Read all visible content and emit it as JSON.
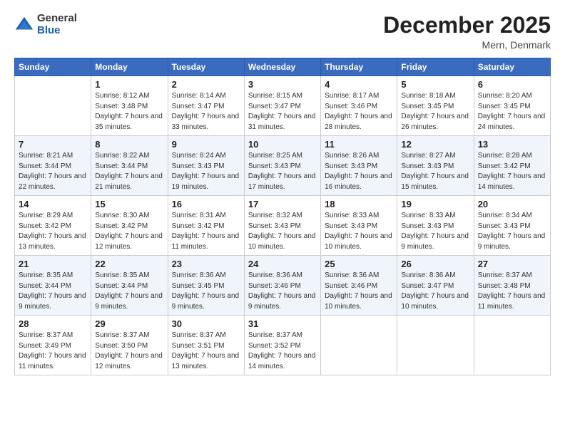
{
  "logo": {
    "general": "General",
    "blue": "Blue"
  },
  "calendar": {
    "title": "December 2025",
    "subtitle": "Mern, Denmark",
    "headers": [
      "Sunday",
      "Monday",
      "Tuesday",
      "Wednesday",
      "Thursday",
      "Friday",
      "Saturday"
    ],
    "rows": [
      [
        {
          "day": "",
          "sunrise": "",
          "sunset": "",
          "daylight": ""
        },
        {
          "day": "1",
          "sunrise": "Sunrise: 8:12 AM",
          "sunset": "Sunset: 3:48 PM",
          "daylight": "Daylight: 7 hours and 35 minutes."
        },
        {
          "day": "2",
          "sunrise": "Sunrise: 8:14 AM",
          "sunset": "Sunset: 3:47 PM",
          "daylight": "Daylight: 7 hours and 33 minutes."
        },
        {
          "day": "3",
          "sunrise": "Sunrise: 8:15 AM",
          "sunset": "Sunset: 3:47 PM",
          "daylight": "Daylight: 7 hours and 31 minutes."
        },
        {
          "day": "4",
          "sunrise": "Sunrise: 8:17 AM",
          "sunset": "Sunset: 3:46 PM",
          "daylight": "Daylight: 7 hours and 28 minutes."
        },
        {
          "day": "5",
          "sunrise": "Sunrise: 8:18 AM",
          "sunset": "Sunset: 3:45 PM",
          "daylight": "Daylight: 7 hours and 26 minutes."
        },
        {
          "day": "6",
          "sunrise": "Sunrise: 8:20 AM",
          "sunset": "Sunset: 3:45 PM",
          "daylight": "Daylight: 7 hours and 24 minutes."
        }
      ],
      [
        {
          "day": "7",
          "sunrise": "Sunrise: 8:21 AM",
          "sunset": "Sunset: 3:44 PM",
          "daylight": "Daylight: 7 hours and 22 minutes."
        },
        {
          "day": "8",
          "sunrise": "Sunrise: 8:22 AM",
          "sunset": "Sunset: 3:44 PM",
          "daylight": "Daylight: 7 hours and 21 minutes."
        },
        {
          "day": "9",
          "sunrise": "Sunrise: 8:24 AM",
          "sunset": "Sunset: 3:43 PM",
          "daylight": "Daylight: 7 hours and 19 minutes."
        },
        {
          "day": "10",
          "sunrise": "Sunrise: 8:25 AM",
          "sunset": "Sunset: 3:43 PM",
          "daylight": "Daylight: 7 hours and 17 minutes."
        },
        {
          "day": "11",
          "sunrise": "Sunrise: 8:26 AM",
          "sunset": "Sunset: 3:43 PM",
          "daylight": "Daylight: 7 hours and 16 minutes."
        },
        {
          "day": "12",
          "sunrise": "Sunrise: 8:27 AM",
          "sunset": "Sunset: 3:43 PM",
          "daylight": "Daylight: 7 hours and 15 minutes."
        },
        {
          "day": "13",
          "sunrise": "Sunrise: 8:28 AM",
          "sunset": "Sunset: 3:42 PM",
          "daylight": "Daylight: 7 hours and 14 minutes."
        }
      ],
      [
        {
          "day": "14",
          "sunrise": "Sunrise: 8:29 AM",
          "sunset": "Sunset: 3:42 PM",
          "daylight": "Daylight: 7 hours and 13 minutes."
        },
        {
          "day": "15",
          "sunrise": "Sunrise: 8:30 AM",
          "sunset": "Sunset: 3:42 PM",
          "daylight": "Daylight: 7 hours and 12 minutes."
        },
        {
          "day": "16",
          "sunrise": "Sunrise: 8:31 AM",
          "sunset": "Sunset: 3:42 PM",
          "daylight": "Daylight: 7 hours and 11 minutes."
        },
        {
          "day": "17",
          "sunrise": "Sunrise: 8:32 AM",
          "sunset": "Sunset: 3:43 PM",
          "daylight": "Daylight: 7 hours and 10 minutes."
        },
        {
          "day": "18",
          "sunrise": "Sunrise: 8:33 AM",
          "sunset": "Sunset: 3:43 PM",
          "daylight": "Daylight: 7 hours and 10 minutes."
        },
        {
          "day": "19",
          "sunrise": "Sunrise: 8:33 AM",
          "sunset": "Sunset: 3:43 PM",
          "daylight": "Daylight: 7 hours and 9 minutes."
        },
        {
          "day": "20",
          "sunrise": "Sunrise: 8:34 AM",
          "sunset": "Sunset: 3:43 PM",
          "daylight": "Daylight: 7 hours and 9 minutes."
        }
      ],
      [
        {
          "day": "21",
          "sunrise": "Sunrise: 8:35 AM",
          "sunset": "Sunset: 3:44 PM",
          "daylight": "Daylight: 7 hours and 9 minutes."
        },
        {
          "day": "22",
          "sunrise": "Sunrise: 8:35 AM",
          "sunset": "Sunset: 3:44 PM",
          "daylight": "Daylight: 7 hours and 9 minutes."
        },
        {
          "day": "23",
          "sunrise": "Sunrise: 8:36 AM",
          "sunset": "Sunset: 3:45 PM",
          "daylight": "Daylight: 7 hours and 9 minutes."
        },
        {
          "day": "24",
          "sunrise": "Sunrise: 8:36 AM",
          "sunset": "Sunset: 3:46 PM",
          "daylight": "Daylight: 7 hours and 9 minutes."
        },
        {
          "day": "25",
          "sunrise": "Sunrise: 8:36 AM",
          "sunset": "Sunset: 3:46 PM",
          "daylight": "Daylight: 7 hours and 10 minutes."
        },
        {
          "day": "26",
          "sunrise": "Sunrise: 8:36 AM",
          "sunset": "Sunset: 3:47 PM",
          "daylight": "Daylight: 7 hours and 10 minutes."
        },
        {
          "day": "27",
          "sunrise": "Sunrise: 8:37 AM",
          "sunset": "Sunset: 3:48 PM",
          "daylight": "Daylight: 7 hours and 11 minutes."
        }
      ],
      [
        {
          "day": "28",
          "sunrise": "Sunrise: 8:37 AM",
          "sunset": "Sunset: 3:49 PM",
          "daylight": "Daylight: 7 hours and 11 minutes."
        },
        {
          "day": "29",
          "sunrise": "Sunrise: 8:37 AM",
          "sunset": "Sunset: 3:50 PM",
          "daylight": "Daylight: 7 hours and 12 minutes."
        },
        {
          "day": "30",
          "sunrise": "Sunrise: 8:37 AM",
          "sunset": "Sunset: 3:51 PM",
          "daylight": "Daylight: 7 hours and 13 minutes."
        },
        {
          "day": "31",
          "sunrise": "Sunrise: 8:37 AM",
          "sunset": "Sunset: 3:52 PM",
          "daylight": "Daylight: 7 hours and 14 minutes."
        },
        {
          "day": "",
          "sunrise": "",
          "sunset": "",
          "daylight": ""
        },
        {
          "day": "",
          "sunrise": "",
          "sunset": "",
          "daylight": ""
        },
        {
          "day": "",
          "sunrise": "",
          "sunset": "",
          "daylight": ""
        }
      ]
    ]
  }
}
